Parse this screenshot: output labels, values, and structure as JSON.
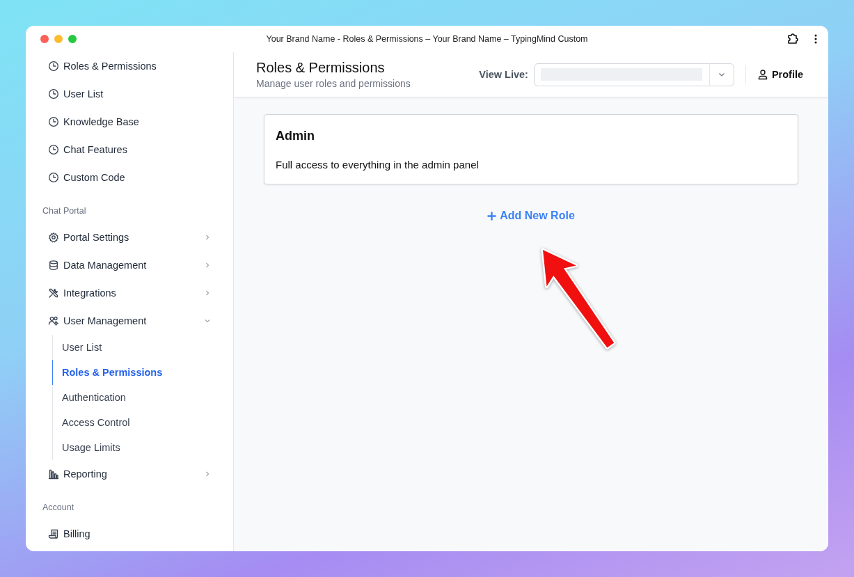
{
  "window": {
    "title": "Your Brand Name - Roles & Permissions – Your Brand Name – TypingMind Custom"
  },
  "sidebar": {
    "sections": [
      {
        "items": [
          {
            "label": "Roles & Permissions",
            "kind": "clock"
          },
          {
            "label": "User List",
            "kind": "clock"
          },
          {
            "label": "Knowledge Base",
            "kind": "clock"
          },
          {
            "label": "Chat Features",
            "kind": "clock"
          },
          {
            "label": "Custom Code",
            "kind": "clock"
          }
        ]
      },
      {
        "heading": "Chat Portal",
        "items": [
          {
            "label": "Portal Settings",
            "kind": "gear",
            "expanded": false
          },
          {
            "label": "Data Management",
            "kind": "database",
            "expanded": false
          },
          {
            "label": "Integrations",
            "kind": "tools",
            "expanded": false
          },
          {
            "label": "User Management",
            "kind": "users",
            "expanded": true,
            "children": [
              {
                "label": "User List",
                "selected": false
              },
              {
                "label": "Roles & Permissions",
                "selected": true
              },
              {
                "label": "Authentication",
                "selected": false
              },
              {
                "label": "Access Control",
                "selected": false
              },
              {
                "label": "Usage Limits",
                "selected": false
              }
            ]
          },
          {
            "label": "Reporting",
            "kind": "chart",
            "expanded": false
          }
        ]
      },
      {
        "heading": "Account",
        "items": [
          {
            "label": "Billing",
            "kind": "receipt"
          }
        ]
      }
    ]
  },
  "header": {
    "title": "Roles & Permissions",
    "subtitle": "Manage user roles and permissions",
    "view_live_label": "View Live:",
    "profile": "Profile"
  },
  "roles": [
    {
      "name": "Admin",
      "description": "Full access to everything in the admin panel"
    }
  ],
  "add_button": "Add New Role"
}
